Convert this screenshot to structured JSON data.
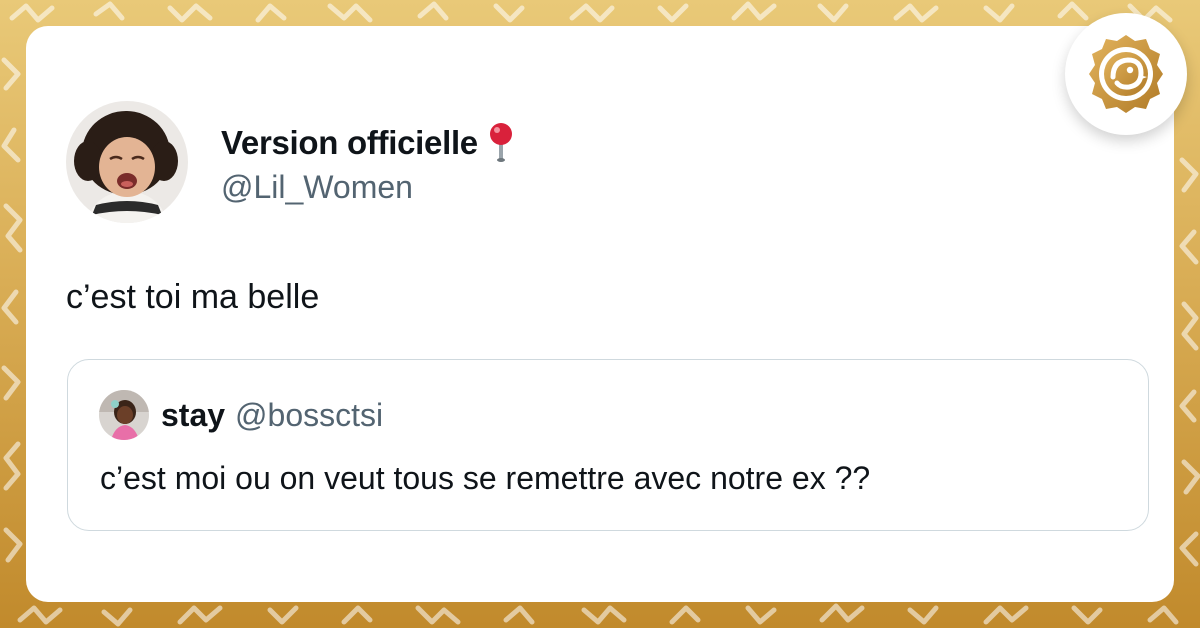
{
  "colors": {
    "background_top": "#e9c978",
    "background_bottom": "#c18a2c",
    "card": "#ffffff",
    "text_primary": "#0f1419",
    "text_secondary": "#536471",
    "quote_border": "#cfd9de",
    "brand_gold": "#c8923a"
  },
  "tweet": {
    "author": {
      "display_name": "Version officielle",
      "badge_icon": "round-pushpin-icon",
      "handle": "@Lil_Women",
      "avatar": "crying-toddler-avatar"
    },
    "text": "c’est toi ma belle",
    "quoted": {
      "display_name": "stay",
      "handle": "@bossctsi",
      "avatar": "child-photo-avatar",
      "text": "c’est moi ou on veut tous se remettre avec notre ex ??"
    }
  },
  "brand": {
    "logo_icon": "gold-seal-logo"
  }
}
